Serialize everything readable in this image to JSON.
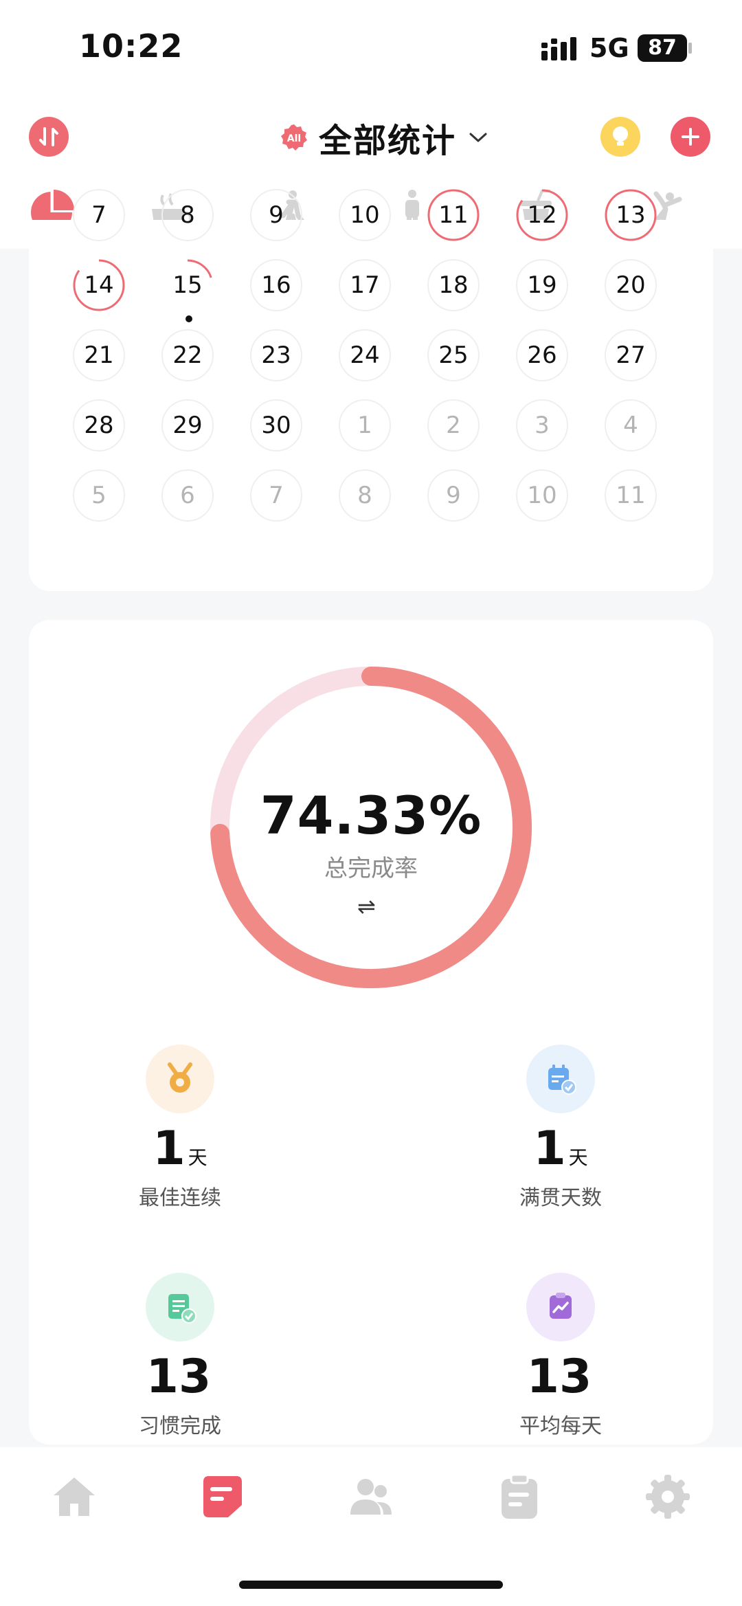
{
  "status": {
    "time": "10:22",
    "network": "5G",
    "battery": "87"
  },
  "header": {
    "title": "全部统计",
    "badge": "All"
  },
  "calendar": {
    "rows": [
      [
        {
          "d": "7",
          "o": false
        },
        {
          "d": "8",
          "o": false
        },
        {
          "d": "9",
          "o": false
        },
        {
          "d": "10",
          "o": false
        },
        {
          "d": "11",
          "o": false,
          "ring": 1.0
        },
        {
          "d": "12",
          "o": false,
          "ring": 0.85
        },
        {
          "d": "13",
          "o": false,
          "ring": 1.0
        }
      ],
      [
        {
          "d": "14",
          "o": false,
          "ring": 0.85
        },
        {
          "d": "15",
          "o": false,
          "ring": 0.2,
          "dot": true
        },
        {
          "d": "16",
          "o": false
        },
        {
          "d": "17",
          "o": false
        },
        {
          "d": "18",
          "o": false
        },
        {
          "d": "19",
          "o": false
        },
        {
          "d": "20",
          "o": false
        }
      ],
      [
        {
          "d": "21",
          "o": false
        },
        {
          "d": "22",
          "o": false
        },
        {
          "d": "23",
          "o": false
        },
        {
          "d": "24",
          "o": false
        },
        {
          "d": "25",
          "o": false
        },
        {
          "d": "26",
          "o": false
        },
        {
          "d": "27",
          "o": false
        }
      ],
      [
        {
          "d": "28",
          "o": false
        },
        {
          "d": "29",
          "o": false
        },
        {
          "d": "30",
          "o": false
        },
        {
          "d": "1",
          "o": true
        },
        {
          "d": "2",
          "o": true
        },
        {
          "d": "3",
          "o": true
        },
        {
          "d": "4",
          "o": true
        }
      ],
      [
        {
          "d": "5",
          "o": true
        },
        {
          "d": "6",
          "o": true
        },
        {
          "d": "7",
          "o": true
        },
        {
          "d": "8",
          "o": true
        },
        {
          "d": "9",
          "o": true
        },
        {
          "d": "10",
          "o": true
        },
        {
          "d": "11",
          "o": true
        }
      ]
    ]
  },
  "summary": {
    "rate": "74.33%",
    "rate_fraction": 0.7433,
    "rate_label": "总完成率",
    "swap": "⇌"
  },
  "stats": [
    {
      "num": "1",
      "unit": "天",
      "label": "最佳连续",
      "icon": "medal-icon",
      "bg": "#fdf1e4",
      "fg": "#f0ac45"
    },
    {
      "num": "1",
      "unit": "天",
      "label": "满贯天数",
      "icon": "calendar-check-icon",
      "bg": "#e7f2fd",
      "fg": "#6aa9ee"
    },
    {
      "num": "13",
      "unit": "",
      "label": "习惯完成",
      "icon": "checklist-icon",
      "bg": "#e3f6ee",
      "fg": "#55c99a"
    },
    {
      "num": "13",
      "unit": "",
      "label": "平均每天",
      "icon": "trend-clipboard-icon",
      "bg": "#f1e8fb",
      "fg": "#a06ad9"
    }
  ],
  "colors": {
    "accent": "#ee6b74",
    "ring": "#ef8a86",
    "ring_track": "#f8dfe6",
    "icon_gray": "#d4d4d4"
  }
}
